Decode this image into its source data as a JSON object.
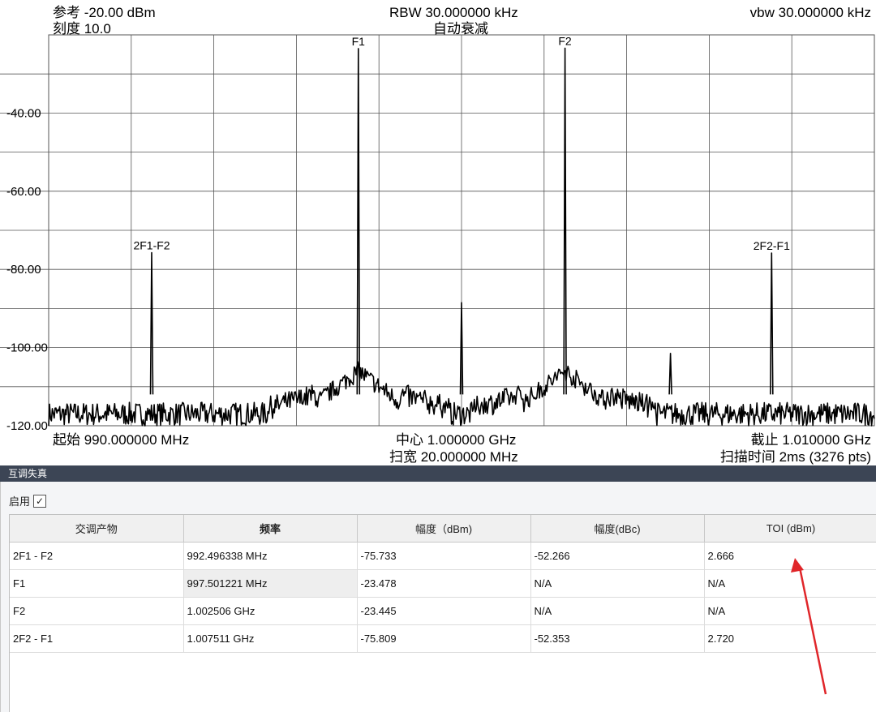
{
  "header": {
    "ref": "参考 -20.00 dBm",
    "scale": "刻度 10.0",
    "rbw": "RBW 30.000000 kHz",
    "atten": "自动衰减",
    "vbw": "vbw 30.000000 kHz",
    "start": "起始 990.000000 MHz",
    "center": "中心 1.000000 GHz",
    "span": "扫宽 20.000000 MHz",
    "stop": "截止 1.010000 GHz",
    "sweep": "扫描时间 2ms (3276 pts)"
  },
  "chart_data": {
    "type": "line",
    "x_range": [
      990,
      1010
    ],
    "ylim": [
      -120,
      -20
    ],
    "y_ticks": [
      "-40.00",
      "-60.00",
      "-80.00",
      "-100.00",
      "-120.00"
    ],
    "grid": true,
    "noise_floor": -117,
    "peaks": [
      {
        "label": "2F1-F2",
        "x": 992.496,
        "y": -75.7
      },
      {
        "label": "F1",
        "x": 997.501,
        "y": -23.5
      },
      {
        "label": "",
        "x": 1000.0,
        "y": -88.5
      },
      {
        "label": "F2",
        "x": 1002.506,
        "y": -23.4
      },
      {
        "label": "",
        "x": 1005.06,
        "y": -101.5
      },
      {
        "label": "2F2-F1",
        "x": 1007.511,
        "y": -75.8
      }
    ]
  },
  "panel": {
    "title": "互调失真",
    "enable_label": "启用",
    "enable_check": "✓",
    "columns": [
      "交调产物",
      "频率",
      "幅度（dBm)",
      "幅度(dBc)",
      "TOI (dBm)"
    ],
    "rows": [
      [
        "2F1 - F2",
        "992.496338 MHz",
        "-75.733",
        "-52.266",
        "2.666"
      ],
      [
        "F1",
        "997.501221 MHz",
        "-23.478",
        "N/A",
        "N/A"
      ],
      [
        "F2",
        "1.002506 GHz",
        "-23.445",
        "N/A",
        "N/A"
      ],
      [
        "2F2 - F1",
        "1.007511 GHz",
        "-75.809",
        "-52.353",
        "2.720"
      ]
    ]
  },
  "colors": {
    "trace": "#000000",
    "grid": "#555555",
    "panel_bar": "#3c4555",
    "annotation_arrow": "#e0262a"
  }
}
